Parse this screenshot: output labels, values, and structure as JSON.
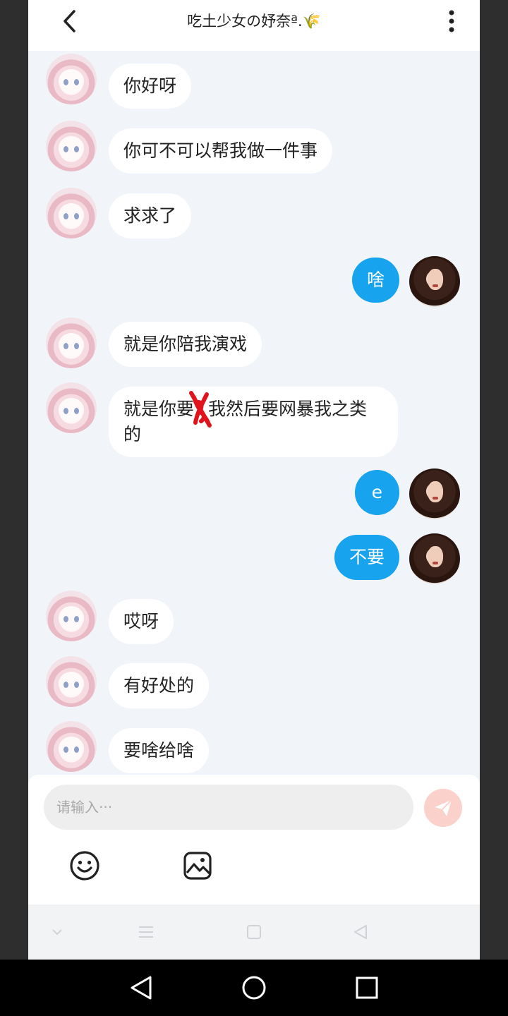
{
  "header": {
    "title": "吃土少女の妤奈ª.🌾"
  },
  "messages": [
    {
      "sender": "other",
      "text": "你好呀"
    },
    {
      "sender": "other",
      "text": "你可不可以帮我做一件事"
    },
    {
      "sender": "other",
      "text": "求求了"
    },
    {
      "sender": "me",
      "text": "啥"
    },
    {
      "sender": "other",
      "text": "就是你陪我演戏"
    },
    {
      "sender": "other",
      "text_before": "就是你要",
      "text_after": "我然后要网暴我之类的"
    },
    {
      "sender": "me",
      "text": "e"
    },
    {
      "sender": "me",
      "text": "不要"
    },
    {
      "sender": "other",
      "text": "哎呀"
    },
    {
      "sender": "other",
      "text": "有好处的"
    },
    {
      "sender": "other",
      "text": "要啥给啥"
    }
  ],
  "composer": {
    "placeholder": "请输入···"
  },
  "colors": {
    "my_bubble": "#18a3ee",
    "other_bubble": "#ffffff",
    "chat_background": "#f1f4f8",
    "send_button": "#fbd1cc"
  },
  "icons": {
    "back": "chevron-left-icon",
    "more": "more-vertical-icon",
    "send": "paper-plane-icon",
    "emoji": "smiley-icon",
    "image": "image-icon"
  }
}
